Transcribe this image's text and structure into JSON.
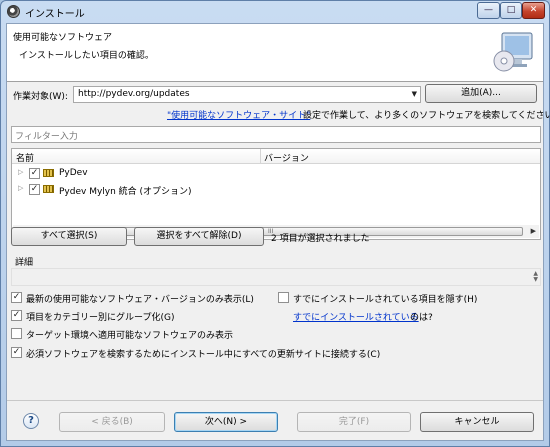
{
  "window": {
    "title": "インストール",
    "min_glyph": "—",
    "max_glyph": "□",
    "close_glyph": "✕"
  },
  "header": {
    "title": "使用可能なソフトウェア",
    "description": "インストールしたい項目の確認。"
  },
  "work_with": {
    "label": "作業対象(W):",
    "value": "http://pydev.org/updates",
    "add_button": "追加(A)...",
    "hint_link": "\"使用可能なソフトウェア・サイト\"",
    "hint_text": "設定で作業して、より多くのソフトウェアを検索してください。"
  },
  "filter": {
    "placeholder": "フィルター入力"
  },
  "tree": {
    "columns": [
      "名前",
      "バージョン"
    ],
    "rows": [
      {
        "label": "PyDev",
        "checked": true
      },
      {
        "label": "Pydev Mylyn 統合 (オプション)",
        "checked": true
      }
    ],
    "scroll_grip": "III"
  },
  "selection": {
    "select_all": "すべて選択(S)",
    "deselect_all": "選択をすべて解除(D)",
    "status": "2 項目が選択されました"
  },
  "details": {
    "label": "詳細"
  },
  "options": {
    "latest_only": {
      "label": "最新の使用可能なソフトウェア・バージョンのみ表示(L)",
      "checked": true
    },
    "hide_installed": {
      "label": "すでにインストールされている項目を隠す(H)",
      "checked": false
    },
    "group_by_category": {
      "label": "項目をカテゴリー別にグループ化(G)",
      "checked": true
    },
    "installed_link": "すでにインストールされている",
    "installed_suffix": "のは?",
    "target_env": {
      "label": "ターゲット環境へ適用可能なソフトウェアのみ表示",
      "checked": false
    },
    "contact_all_sites": {
      "label": "必須ソフトウェアを検索するためにインストール中にすべての更新サイトに接続する(C)",
      "checked": true
    }
  },
  "footer": {
    "help": "?",
    "back": "< 戻る(B)",
    "next": "次へ(N) >",
    "finish": "完了(F)",
    "cancel": "キャンセル"
  }
}
